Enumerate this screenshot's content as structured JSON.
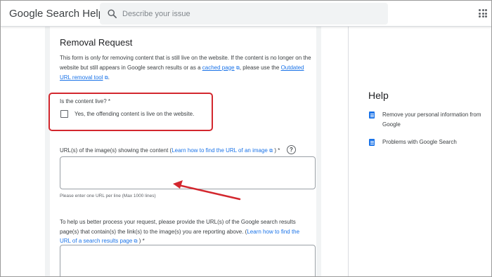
{
  "header": {
    "app_title": "Google Search Help",
    "search_placeholder": "Describe your issue"
  },
  "form": {
    "title": "Removal Request",
    "intro_part1": "This form is only for removing content that is still live on the website. If the content is no longer on the website but still appears in Google search results or as a ",
    "intro_link1": "cached page",
    "intro_part2": ", please use the ",
    "intro_link2": "Outdated URL removal tool",
    "intro_part3": ".",
    "ext_icon": "⧉",
    "live_question": "Is the content live? *",
    "live_checkbox_label": "Yes, the offending content is live on the website.",
    "url_question_part1": "URL(s) of the image(s) showing the content (",
    "url_question_link": "Learn how to find the URL of an image",
    "url_question_part2": ") *",
    "help_circle": "?",
    "url_hint": "Please enter one URL per line (Max 1000 lines)",
    "results_question_part1": "To help us better process your request, please provide the URL(s) of the Google search results page(s) that contain(s) the link(s) to the image(s) you are reporting above. (",
    "results_question_link": "Learn how to find the URL of a search results page",
    "results_question_part2": ") *"
  },
  "help_panel": {
    "title": "Help",
    "items": [
      {
        "label": "Remove your personal information from Google",
        "icon": "document-icon"
      },
      {
        "label": "Problems with Google Search",
        "icon": "document-icon"
      }
    ]
  },
  "colors": {
    "annotation_red": "#d3272e",
    "link_blue": "#1a73e8"
  }
}
